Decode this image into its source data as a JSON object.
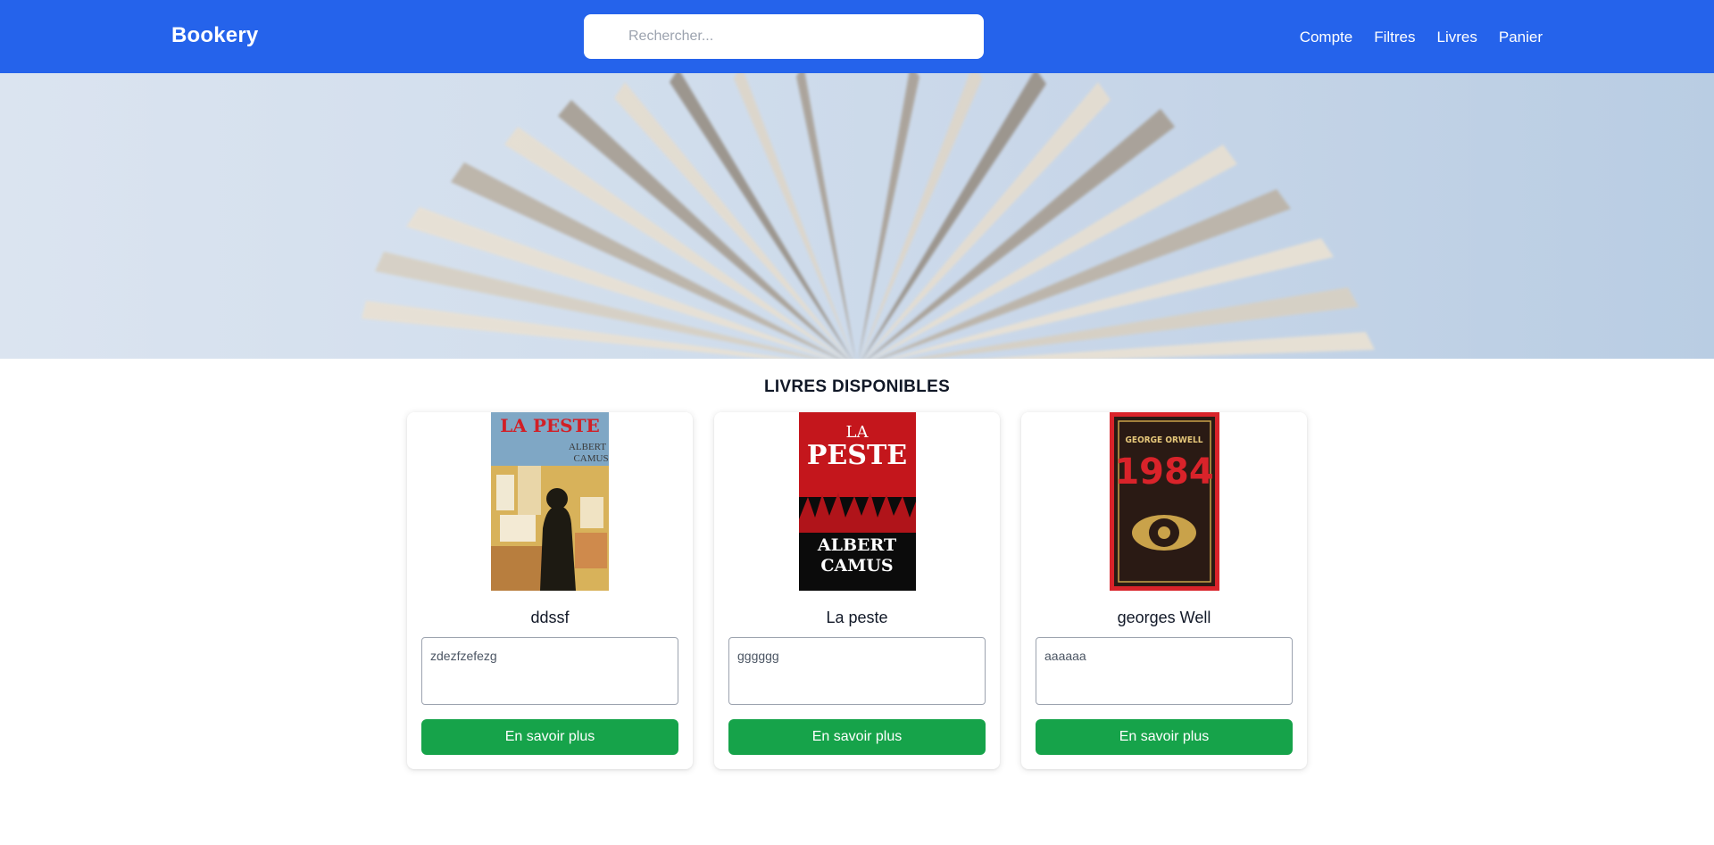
{
  "header": {
    "brand": "Bookery",
    "search_placeholder": "Rechercher...",
    "nav": [
      "Compte",
      "Filtres",
      "Livres",
      "Panier"
    ]
  },
  "section": {
    "title": "LIVRES DISPONIBLES"
  },
  "books": [
    {
      "title": "ddssf",
      "description": "zdezfzefezg",
      "button": "En savoir plus",
      "cover": {
        "title": "LA PESTE",
        "author_line1": "ALBERT",
        "author_line2": "CAMUS"
      }
    },
    {
      "title": "La peste",
      "description": "gggggg",
      "button": "En savoir plus",
      "cover": {
        "title_top": "LA",
        "title": "PESTE",
        "author_line1": "ALBERT",
        "author_line2": "CAMUS"
      }
    },
    {
      "title": "georges Well",
      "description": "aaaaaa",
      "button": "En savoir plus",
      "cover": {
        "author": "GEORGE ORWELL",
        "title": "1984"
      }
    }
  ],
  "colors": {
    "nav": "#2563eb",
    "button": "#16a34a"
  }
}
